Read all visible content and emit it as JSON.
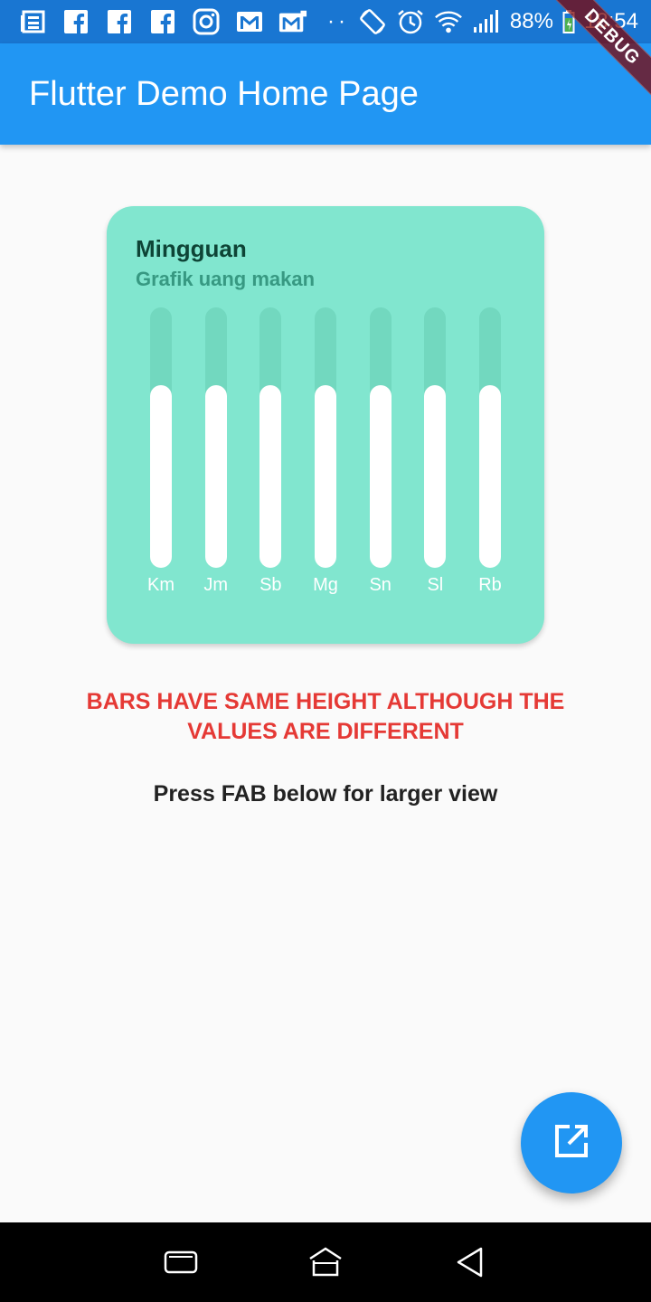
{
  "status_bar": {
    "battery": "88%",
    "time": "18:54",
    "notification_icons": [
      "news-icon",
      "facebook-icon",
      "facebook-icon",
      "facebook-icon",
      "instagram-icon",
      "gmail-icon",
      "gmail-icon"
    ],
    "overflow": "··"
  },
  "debug_banner": "DEBUG",
  "app_bar": {
    "title": "Flutter Demo Home Page",
    "color": "#2196F3"
  },
  "card": {
    "title": "Mingguan",
    "subtitle": "Grafik uang makan",
    "background": "#81E6CF"
  },
  "chart_data": {
    "type": "bar",
    "categories": [
      "Km",
      "Jm",
      "Sb",
      "Mg",
      "Sn",
      "Sl",
      "Rb"
    ],
    "values": [
      0.7,
      0.7,
      0.7,
      0.7,
      0.7,
      0.7,
      0.7
    ],
    "ylim": [
      0,
      1
    ],
    "bar_color": "#FFFFFF",
    "track_color": "#72D8BF",
    "grid": false
  },
  "warning": "BARS HAVE SAME HEIGHT ALTHOUGH THE VALUES ARE DIFFERENT",
  "instruction": "Press FAB below for larger view",
  "fab": {
    "icon": "open-in-new-icon",
    "color": "#2196F3"
  },
  "nav_bar": {
    "buttons": [
      "recent-apps-icon",
      "home-icon",
      "back-icon"
    ]
  }
}
